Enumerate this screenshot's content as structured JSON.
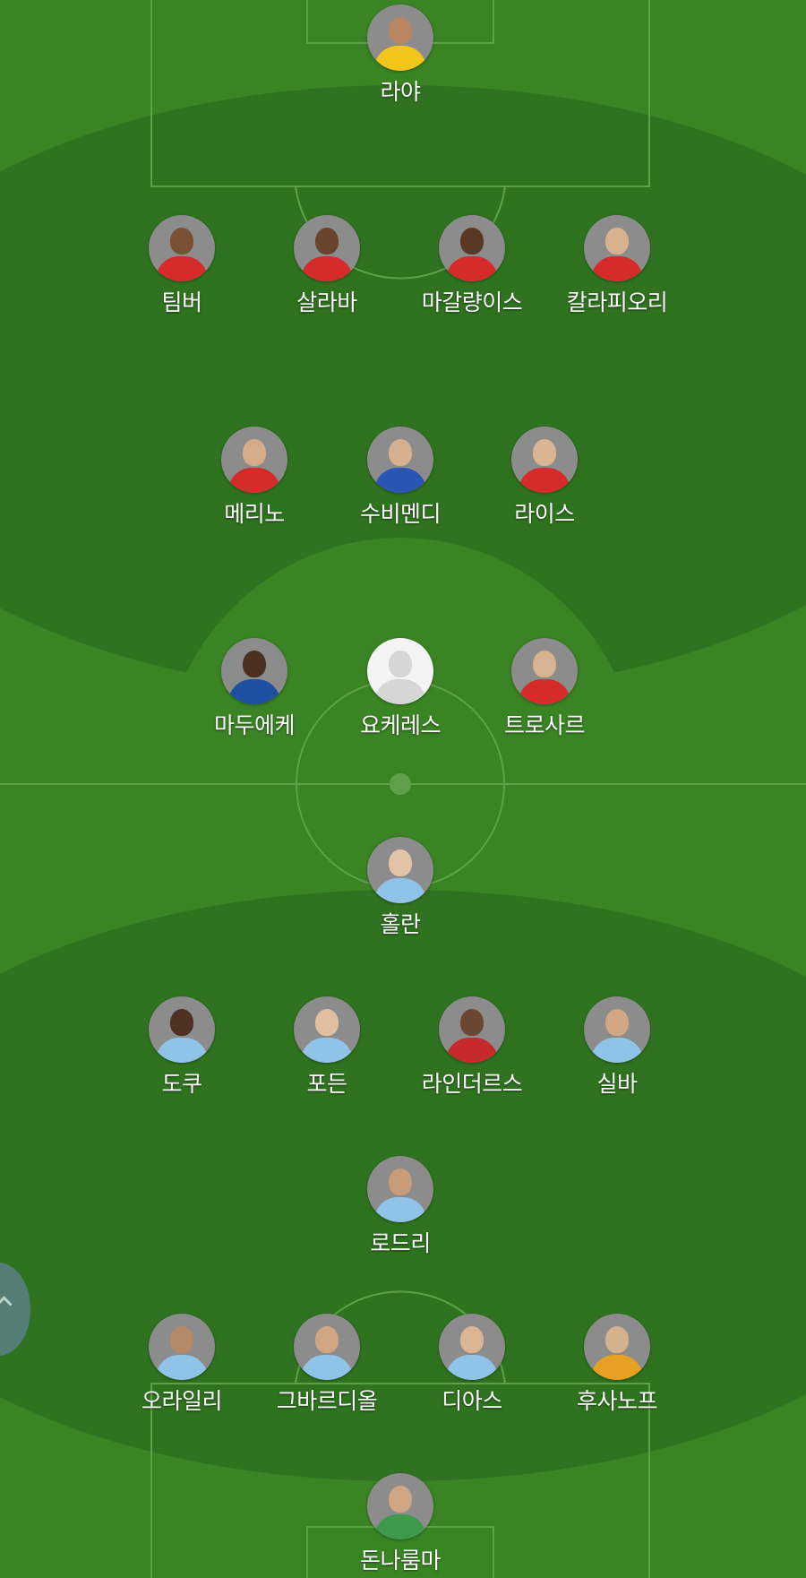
{
  "colors": {
    "pitch": "#3a8424",
    "pitch_dark": "#2f7320",
    "line": "#5fa14a",
    "label": "#ffffff"
  },
  "team_top": {
    "goalkeeper": [
      {
        "name": "라야",
        "kit": "#f2c51c",
        "skin": "#b88563"
      }
    ],
    "defenders": [
      {
        "name": "팀버",
        "kit": "#d62b2b",
        "skin": "#7a5134"
      },
      {
        "name": "살라바",
        "kit": "#d62b2b",
        "skin": "#6a452d"
      },
      {
        "name": "마갈량이스",
        "kit": "#d62b2b",
        "skin": "#5a3924"
      },
      {
        "name": "칼라피오리",
        "kit": "#d62b2b",
        "skin": "#d8b18f"
      }
    ],
    "midfielders": [
      {
        "name": "메리노",
        "kit": "#d62b2b",
        "skin": "#d5ab8a"
      },
      {
        "name": "수비멘디",
        "kit": "#2a55b5",
        "skin": "#d7b08f"
      },
      {
        "name": "라이스",
        "kit": "#d62b2b",
        "skin": "#dab592"
      }
    ],
    "forwards": [
      {
        "name": "마두에케",
        "kit": "#1f4fa0",
        "skin": "#4b3020"
      },
      {
        "name": "요케레스",
        "kit": "",
        "skin": "",
        "placeholder": true
      },
      {
        "name": "트로사르",
        "kit": "#d62b2b",
        "skin": "#d8b391"
      }
    ]
  },
  "team_bottom": {
    "striker": [
      {
        "name": "홀란",
        "kit": "#8fc3e8",
        "skin": "#e3c3a6"
      }
    ],
    "attacking_mid": [
      {
        "name": "도쿠",
        "kit": "#8fc3e8",
        "skin": "#4f3121"
      },
      {
        "name": "포든",
        "kit": "#8fc3e8",
        "skin": "#e0bea0"
      },
      {
        "name": "라인더르스",
        "kit": "#c62a2a",
        "skin": "#6b4630"
      },
      {
        "name": "실바",
        "kit": "#8fc3e8",
        "skin": "#d2a783"
      }
    ],
    "holding_mid": [
      {
        "name": "로드리",
        "kit": "#8fc3e8",
        "skin": "#c99c79"
      }
    ],
    "defenders": [
      {
        "name": "오라일리",
        "kit": "#8fc3e8",
        "skin": "#b68a66"
      },
      {
        "name": "그바르디올",
        "kit": "#8fc3e8",
        "skin": "#d0a582"
      },
      {
        "name": "디아스",
        "kit": "#8fc3e8",
        "skin": "#dcb594"
      },
      {
        "name": "후사노프",
        "kit": "#e7a021",
        "skin": "#d6b18d"
      }
    ],
    "goalkeeper": [
      {
        "name": "돈나룸마",
        "kit": "#3d9a4a",
        "skin": "#cfa583"
      }
    ]
  },
  "side_button": {
    "icon": "chevron-up-icon"
  }
}
